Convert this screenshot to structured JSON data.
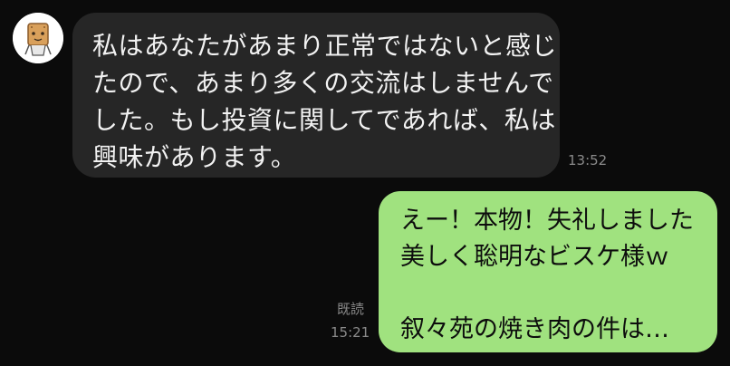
{
  "incoming": {
    "sender_avatar_icon": "biscuit-character-icon",
    "lines": [
      "私はあなたがあまり正常ではないと感じ",
      "たので、あまり多くの交流はしませんで",
      "した。もし投資に関してであれば、私は",
      "興味があります。"
    ],
    "time": "13:52",
    "bubble_color": "#262626"
  },
  "outgoing": {
    "lines": [
      "えー！本物！失礼しました",
      "美しく聡明なビスケ様ｗ",
      "",
      "叙々苑の焼き肉の件は…"
    ],
    "read_status": "既読",
    "time": "15:21",
    "bubble_color": "#a0e27f"
  }
}
